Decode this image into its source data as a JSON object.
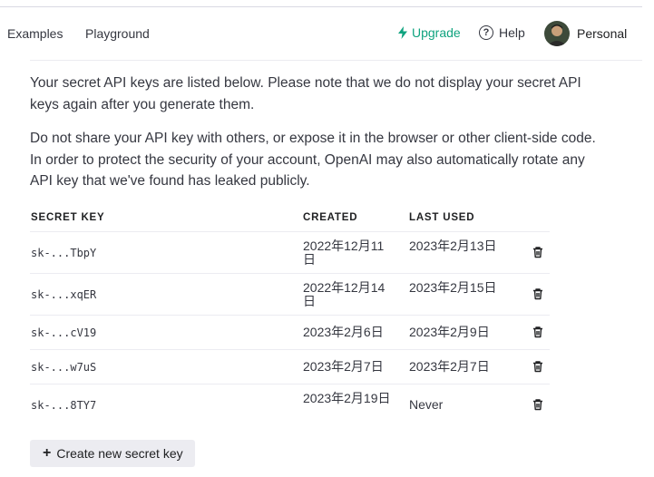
{
  "header": {
    "examples_label": "Examples",
    "playground_label": "Playground",
    "upgrade_label": "Upgrade",
    "help_label": "Help",
    "account_label": "Personal"
  },
  "intro": {
    "paragraph1": "Your secret API keys are listed below. Please note that we do not display your secret API keys again after you generate them.",
    "paragraph2": "Do not share your API key with others, or expose it in the browser or other client-side code. In order to protect the security of your account, OpenAI may also automatically rotate any API key that we've found has leaked publicly."
  },
  "table": {
    "headers": {
      "key": "SECRET KEY",
      "created": "CREATED",
      "last_used": "LAST USED"
    },
    "rows": [
      {
        "key": "sk-...TbpY",
        "created": "2022年12月11日",
        "last_used": "2023年2月13日"
      },
      {
        "key": "sk-...xqER",
        "created": "2022年12月14日",
        "last_used": "2023年2月15日"
      },
      {
        "key": "sk-...cV19",
        "created": "2023年2月6日",
        "last_used": "2023年2月9日"
      },
      {
        "key": "sk-...w7uS",
        "created": "2023年2月7日",
        "last_used": "2023年2月7日"
      },
      {
        "key": "sk-...8TY7",
        "created": "2023年2月19日",
        "last_used": "Never"
      }
    ]
  },
  "actions": {
    "create_label": "Create new secret key"
  },
  "colors": {
    "accent": "#10a37f",
    "button_bg": "#ececf1",
    "text": "#353740"
  }
}
